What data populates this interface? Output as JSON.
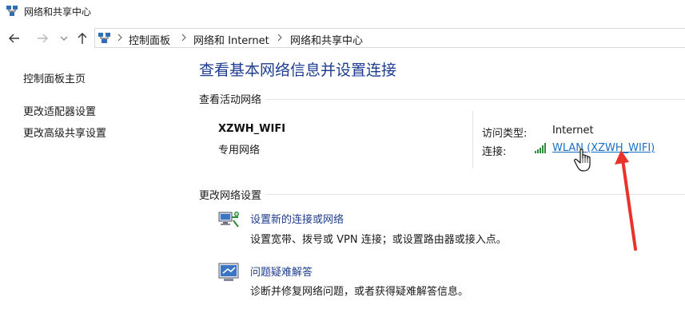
{
  "window": {
    "title": "网络和共享中心"
  },
  "breadcrumb": [
    "控制面板",
    "网络和 Internet",
    "网络和共享中心"
  ],
  "sidebar": {
    "items": [
      {
        "label": "控制面板主页"
      },
      {
        "label": "更改适配器设置"
      },
      {
        "label": "更改高级共享设置"
      }
    ]
  },
  "main": {
    "title": "查看基本网络信息并设置连接",
    "active_section": "查看活动网络",
    "network": {
      "name": "XZWH_WIFI",
      "type": "专用网络",
      "access_type_label": "访问类型:",
      "access_type_value": "Internet",
      "connection_label": "连接:",
      "connection_value": "WLAN (XZWH_WIFI)"
    },
    "change_section": "更改网络设置",
    "tasks": [
      {
        "link": "设置新的连接或网络",
        "desc": "设置宽带、拨号或 VPN 连接；或设置路由器或接入点。"
      },
      {
        "link": "问题疑难解答",
        "desc": "诊断并修复网络问题，或者获得疑难解答信息。"
      }
    ]
  },
  "colors": {
    "link": "#1a6fc6",
    "title": "#1e3d8f",
    "annotation_arrow": "#e8322a"
  }
}
